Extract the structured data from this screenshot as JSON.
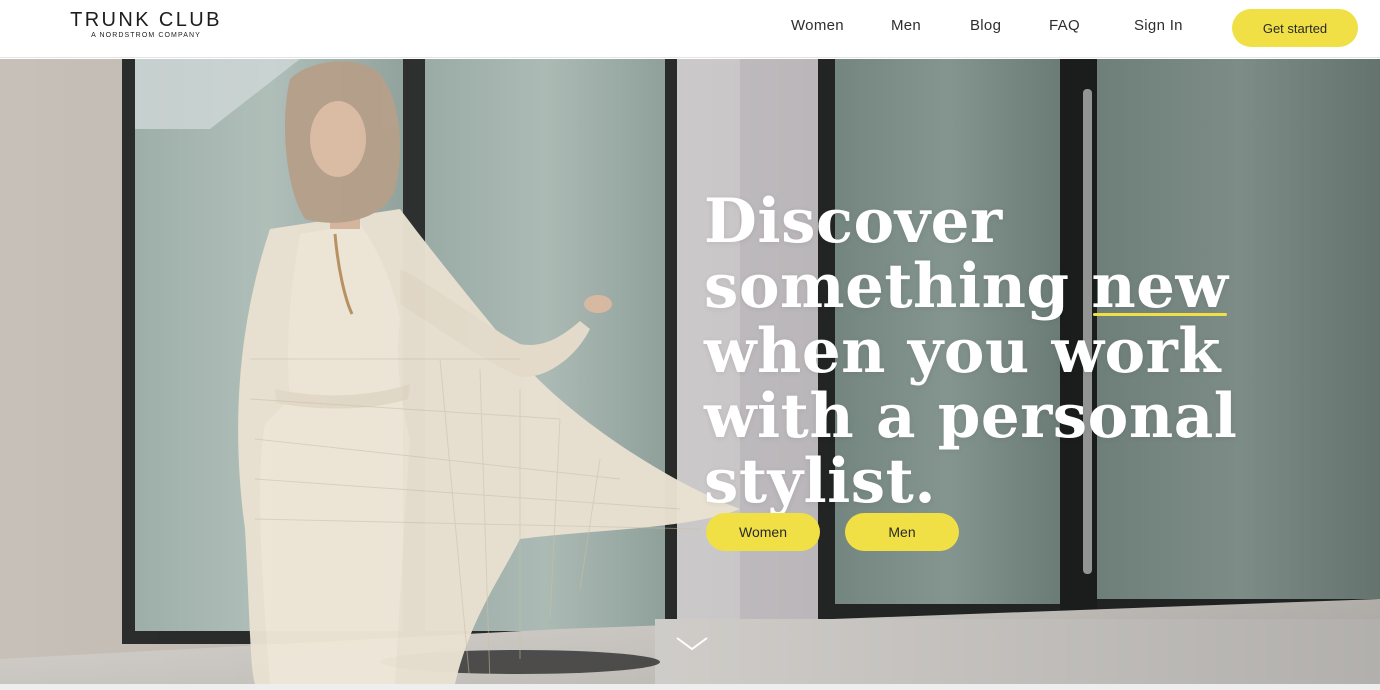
{
  "header": {
    "logo": {
      "main": "TRUNK CLUB",
      "sub": "A NORDSTROM COMPANY"
    },
    "nav": [
      {
        "label": "Women"
      },
      {
        "label": "Men"
      },
      {
        "label": "Blog"
      },
      {
        "label": "FAQ"
      },
      {
        "label": "Sign In"
      }
    ],
    "cta_label": "Get started"
  },
  "hero": {
    "headline": {
      "line1": "Discover",
      "line2_pre": "something ",
      "line2_emph": "new",
      "line3": "when you work",
      "line4": "with a personal",
      "line5": "stylist."
    },
    "buttons": [
      {
        "label": "Women"
      },
      {
        "label": "Men"
      }
    ],
    "scroll_icon": "chevron-down-icon"
  },
  "colors": {
    "accent": "#f0e046",
    "text_dark": "#2a2a2a",
    "headline": "#ffffff"
  }
}
